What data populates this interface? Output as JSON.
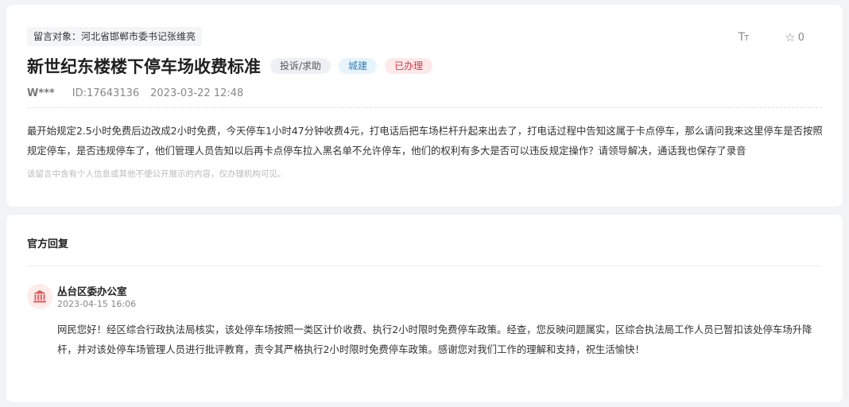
{
  "message": {
    "target": "留言对象：河北省邯郸市委书记张维亮",
    "font_toggle": {
      "icon": "font-size-icon",
      "label_big": "T",
      "label_small": "T"
    },
    "favorite": {
      "icon": "star-outline-icon",
      "count": "0"
    },
    "title": "新世纪东楼楼下停车场收费标准",
    "tags": {
      "type": "投诉/求助",
      "category": "城建",
      "status": "已办理"
    },
    "author": "W***",
    "id": "ID:17643136",
    "datetime": "2023-03-22 12:48",
    "content": "最开始规定2.5小时免费后边改成2小时免费，今天停车1小时47分钟收费4元，打电话后把车场栏杆升起来出去了，打电话过程中告知这属于卡点停车，那么请问我来这里停车是否按照规定停车，是否违规停车了，他们管理人员告知以后再卡点停车拉入黑名单不允许停车，他们的权利有多大是否可以违反规定操作？请领导解决，通话我也保存了录音",
    "privacy_note": "该留言中含有个人信息或其他不便公开展示的内容，仅办理机构可见。"
  },
  "reply": {
    "header": "官方回复",
    "org_icon": "government-building-icon",
    "org": "丛台区委办公室",
    "date": "2023-04-15 16:06",
    "text": "网民您好！经区综合行政执法局核实，该处停车场按照一类区计价收费、执行2小时限时免费停车政策。经查，您反映问题属实，区综合执法局工作人员已暂扣该处停车场升降杆，并对该处停车场管理人员进行批评教育，责令其严格执行2小时限时免费停车政策。感谢您对我们工作的理解和支持，祝生活愉快！"
  },
  "colors": {
    "status_red": "#d9363e",
    "category_blue": "#3a7fb8",
    "avatar_red": "#e05a5a"
  }
}
